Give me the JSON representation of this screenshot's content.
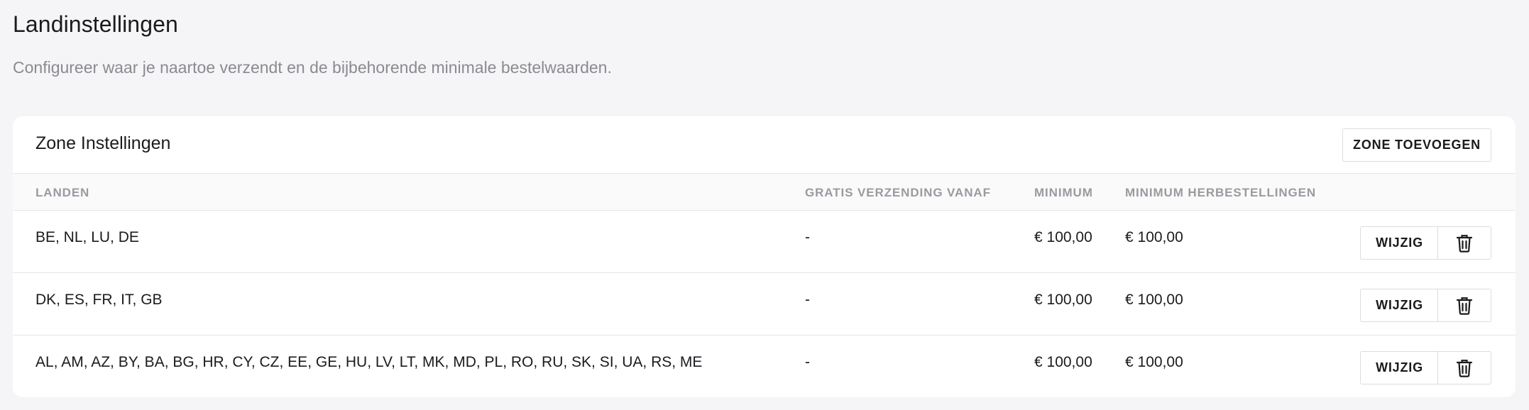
{
  "page": {
    "title": "Landinstellingen",
    "subtitle": "Configureer waar je naartoe verzendt en de bijbehorende minimale bestelwaarden."
  },
  "card": {
    "title": "Zone Instellingen",
    "add_button_label": "ZONE TOEVOEGEN"
  },
  "table": {
    "headers": {
      "countries": "LANDEN",
      "free_shipping": "GRATIS VERZENDING VANAF",
      "minimum": "MINIMUM",
      "minimum_reorders": "MINIMUM HERBESTELLINGEN"
    },
    "rows": [
      {
        "countries": "BE, NL, LU, DE",
        "free_shipping": "-",
        "minimum": "€ 100,00",
        "minimum_reorders": "€ 100,00",
        "edit_label": "WIJZIG",
        "delete_icon": "trash-icon"
      },
      {
        "countries": "DK, ES, FR, IT, GB",
        "free_shipping": "-",
        "minimum": "€ 100,00",
        "minimum_reorders": "€ 100,00",
        "edit_label": "WIJZIG",
        "delete_icon": "trash-icon"
      },
      {
        "countries": "AL, AM, AZ, BY, BA, BG, HR, CY, CZ, EE, GE, HU, LV, LT, MK, MD, PL, RO, RU, SK, SI, UA, RS, ME",
        "free_shipping": "-",
        "minimum": "€ 100,00",
        "minimum_reorders": "€ 100,00",
        "edit_label": "WIJZIG",
        "delete_icon": "trash-icon"
      }
    ]
  },
  "colors": {
    "background": "#f5f5f7",
    "card": "#ffffff",
    "text": "#1b1b1f",
    "muted": "#8a8a90",
    "border": "#e6e6e9"
  }
}
